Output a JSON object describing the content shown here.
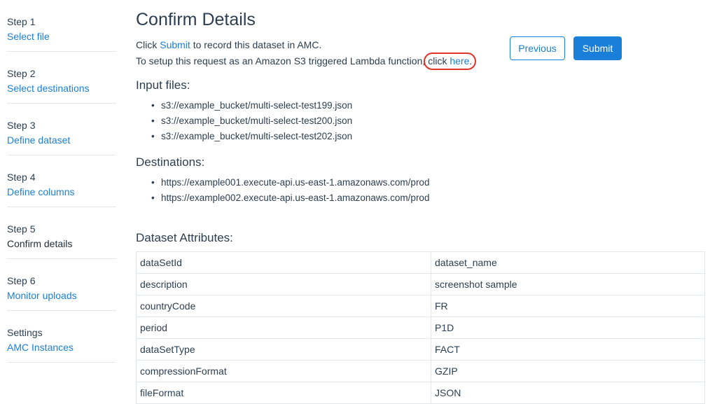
{
  "sidebar": {
    "steps": [
      {
        "num": "Step 1",
        "label": "Select file"
      },
      {
        "num": "Step 2",
        "label": "Select destinations"
      },
      {
        "num": "Step 3",
        "label": "Define dataset"
      },
      {
        "num": "Step 4",
        "label": "Define columns"
      },
      {
        "num": "Step 5",
        "label": "Confirm details"
      },
      {
        "num": "Step 6",
        "label": "Monitor uploads"
      },
      {
        "num": "Settings",
        "label": "AMC Instances"
      }
    ]
  },
  "main": {
    "title": "Confirm Details",
    "intro": {
      "line1_prefix": "Click ",
      "line1_link": "Submit",
      "line1_suffix": " to record this dataset in AMC.",
      "line2_prefix": "To setup this request as an Amazon S3 triggered Lambda function,",
      "line2_click": "click ",
      "line2_link": "here",
      "line2_period": "."
    },
    "buttons": {
      "previous": "Previous",
      "submit": "Submit"
    },
    "input_files_heading": "Input files:",
    "input_files": [
      "s3://example_bucket/multi-select-test199.json",
      "s3://example_bucket/multi-select-test200.json",
      "s3://example_bucket/multi-select-test202.json"
    ],
    "destinations_heading": "Destinations:",
    "destinations": [
      "https://example001.execute-api.us-east-1.amazonaws.com/prod",
      "https://example002.execute-api.us-east-1.amazonaws.com/prod"
    ],
    "attributes_heading": "Dataset Attributes:",
    "attributes": [
      {
        "key": "dataSetId",
        "value": "dataset_name"
      },
      {
        "key": "description",
        "value": "screenshot sample"
      },
      {
        "key": "countryCode",
        "value": "FR"
      },
      {
        "key": "period",
        "value": "P1D"
      },
      {
        "key": "dataSetType",
        "value": "FACT"
      },
      {
        "key": "compressionFormat",
        "value": "GZIP"
      },
      {
        "key": "fileFormat",
        "value": "JSON"
      }
    ]
  },
  "colors": {
    "accent": "#1a7fd8",
    "highlight_circle": "#e0332a",
    "text": "#2c3e50"
  }
}
